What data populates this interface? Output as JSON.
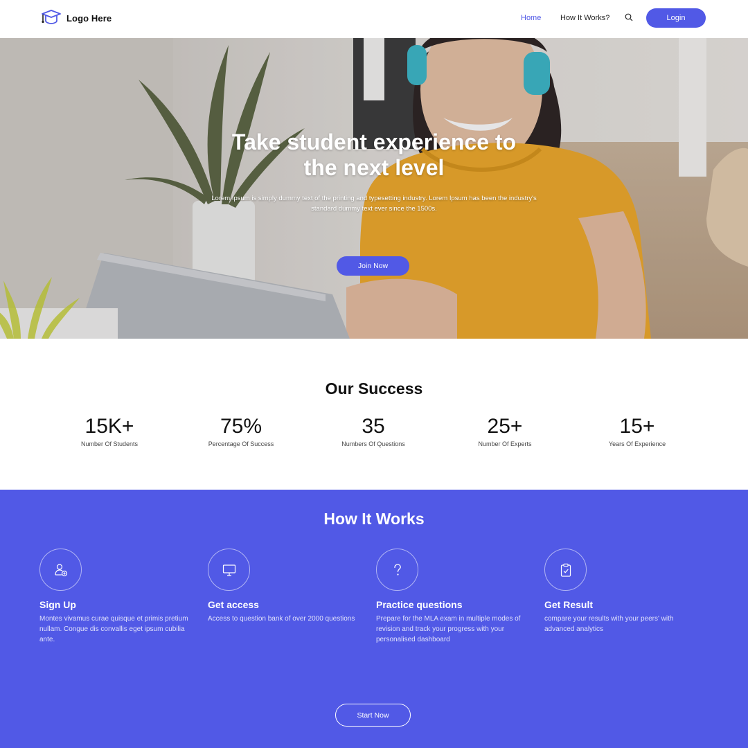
{
  "brand": {
    "logo_text": "Logo Here",
    "accent": "#5159e6"
  },
  "nav": {
    "home": "Home",
    "how_it_works": "How It Works?",
    "login": "Login",
    "search_icon": "search-icon"
  },
  "hero": {
    "title_line1": "Take student experience to",
    "title_line2": "the next level",
    "subtitle_line1": "Lorem Ipsum is simply dummy text of the printing and typesetting industry. Lorem Ipsum has been the industry's",
    "subtitle_line2": "standard dummy text ever since the 1500s.",
    "cta": "Join Now"
  },
  "success": {
    "title": "Our Success",
    "stats": [
      {
        "value": "15K+",
        "label": "Number Of Students"
      },
      {
        "value": "75%",
        "label": "Percentage Of Success"
      },
      {
        "value": "35",
        "label": "Numbers Of Questions"
      },
      {
        "value": "25+",
        "label": "Number Of Experts"
      },
      {
        "value": "15+",
        "label": "Years Of Experience"
      }
    ]
  },
  "how_it_works": {
    "title": "How It Works",
    "steps": [
      {
        "icon": "user-add-icon",
        "title": "Sign Up",
        "desc": "Montes vivamus curae quisque et primis pretium nullam. Congue dis convallis eget ipsum cubilia ante."
      },
      {
        "icon": "monitor-icon",
        "title": "Get access",
        "desc": "Access to question bank of over 2000 questions"
      },
      {
        "icon": "question-icon",
        "title": "Practice questions",
        "desc": "Prepare for the MLA exam in multiple modes of revision and track your progress with your personalised dashboard"
      },
      {
        "icon": "clipboard-check-icon",
        "title": "Get Result",
        "desc": "compare your results with your peers' with advanced analytics"
      }
    ],
    "cta": "Start Now"
  }
}
